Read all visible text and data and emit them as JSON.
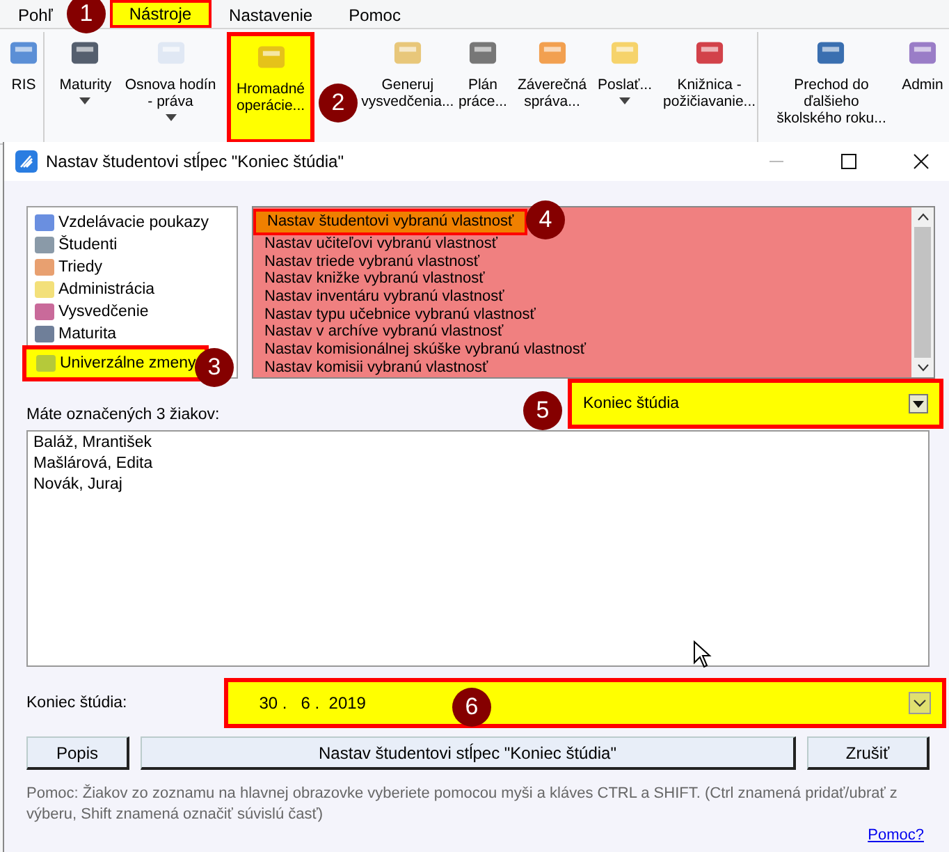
{
  "menu": [
    {
      "label": "Pohľ",
      "highlighted": false
    },
    {
      "label": "Nástroje",
      "highlighted": true
    },
    {
      "label": "Nastavenie",
      "highlighted": false
    },
    {
      "label": "Pomoc",
      "highlighted": false
    }
  ],
  "ribbon": [
    {
      "label": "RIS",
      "dropdown": false,
      "highlighted": false,
      "group_end": true
    },
    {
      "label": "Maturity",
      "dropdown": true,
      "highlighted": false,
      "group_end": false
    },
    {
      "label": "Osnova hodín - práva",
      "dropdown": true,
      "highlighted": false,
      "group_end": false
    },
    {
      "label": "Hromadné operácie...",
      "dropdown": false,
      "highlighted": true,
      "group_end": false
    },
    {
      "label": "Generuj vysvedčenia...",
      "dropdown": false,
      "highlighted": false,
      "group_end": false
    },
    {
      "label": "Plán práce...",
      "dropdown": false,
      "highlighted": false,
      "group_end": false
    },
    {
      "label": "Záverečná správa...",
      "dropdown": false,
      "highlighted": false,
      "group_end": false
    },
    {
      "label": "Poslať...",
      "dropdown": true,
      "highlighted": false,
      "group_end": false
    },
    {
      "label": "Knižnica - požičiavanie...",
      "dropdown": false,
      "highlighted": false,
      "group_end": true
    },
    {
      "label": "Prechod do ďalšieho školského roku...",
      "dropdown": false,
      "highlighted": false,
      "group_end": false
    },
    {
      "label": "Admin",
      "dropdown": false,
      "highlighted": false,
      "group_end": false
    }
  ],
  "dialog": {
    "title": "Nastav študentovi stĺpec \"Koniec štúdia\"",
    "tree": [
      {
        "label": "Vzdelávacie poukazy",
        "highlighted": false
      },
      {
        "label": "Študenti",
        "highlighted": false
      },
      {
        "label": "Triedy",
        "highlighted": false
      },
      {
        "label": "Administrácia",
        "highlighted": false
      },
      {
        "label": "Vysvedčenie",
        "highlighted": false
      },
      {
        "label": "Maturita",
        "highlighted": false
      },
      {
        "label": "Univerzálne zmeny",
        "highlighted": true
      }
    ],
    "operations": [
      {
        "label": "Nastav študentovi vybranú vlastnosť",
        "selected": true,
        "highlighted": true
      },
      {
        "label": "Nastav učiteľovi vybranú vlastnosť",
        "selected": false,
        "highlighted": false
      },
      {
        "label": "Nastav triede vybranú vlastnosť",
        "selected": false,
        "highlighted": false
      },
      {
        "label": "Nastav knižke vybranú vlastnosť",
        "selected": false,
        "highlighted": false
      },
      {
        "label": "Nastav inventáru vybranú vlastnosť",
        "selected": false,
        "highlighted": false
      },
      {
        "label": "Nastav typu učebnice vybranú vlastnosť",
        "selected": false,
        "highlighted": false
      },
      {
        "label": "Nastav v archíve vybranú vlastnosť",
        "selected": false,
        "highlighted": false
      },
      {
        "label": "Nastav komisionálnej skúške vybranú vlastnosť",
        "selected": false,
        "highlighted": false
      },
      {
        "label": "Nastav komisii vybranú vlastnosť",
        "selected": false,
        "highlighted": false
      }
    ],
    "selected_count_label": "Máte označených 3 žiakov:",
    "property_combo": {
      "value": "Koniec štúdia",
      "highlighted": true
    },
    "students": [
      "Baláž, Mrantišek",
      "Mašlárová, Edita",
      "Novák, Juraj"
    ],
    "date_label": "Koniec štúdia:",
    "date_field": {
      "value": "30 .   6 .  2019",
      "highlighted": true
    },
    "buttons": [
      "Popis",
      "Nastav študentovi stĺpec \"Koniec štúdia\"",
      "Zrušiť"
    ],
    "help_text": "Pomoc: Žiakov zo zoznamu na hlavnej obrazovke vyberiete pomocou myši a kláves CTRL a SHIFT. (Ctrl znamená pridať/ubrať z výberu, Shift znamená označiť súvislú časť)",
    "help_link": "Pomoc?"
  },
  "callouts": [
    "1",
    "2",
    "3",
    "4",
    "5",
    "6"
  ]
}
